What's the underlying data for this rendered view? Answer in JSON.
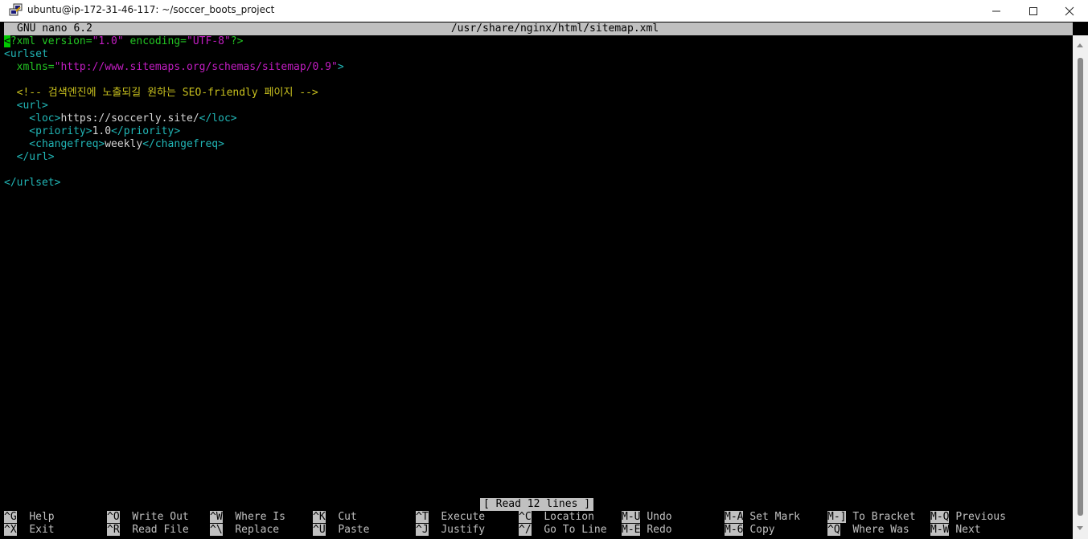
{
  "window": {
    "title": "ubuntu@ip-172-31-46-117: ~/soccer_boots_project",
    "app_icon": "putty-icon",
    "controls": {
      "minimize_icon": "minimize-icon",
      "maximize_icon": "maximize-icon",
      "close_icon": "close-icon"
    }
  },
  "nano": {
    "version_label": "GNU nano 6.2",
    "file_path": "/usr/share/nginx/html/sitemap.xml",
    "status_message": "[ Read 12 lines ]"
  },
  "file_lines": [
    [
      {
        "t": "<",
        "c": "cursor"
      },
      {
        "t": "?xml version=",
        "c": "green"
      },
      {
        "t": "\"1.0\"",
        "c": "magenta"
      },
      {
        "t": " encoding=",
        "c": "green"
      },
      {
        "t": "\"UTF-8\"",
        "c": "magenta"
      },
      {
        "t": "?>",
        "c": "green"
      }
    ],
    [
      {
        "t": "<urlset",
        "c": "teal"
      }
    ],
    [
      {
        "t": "  xmlns=",
        "c": "green"
      },
      {
        "t": "\"http://www.sitemaps.org/schemas/sitemap/0.9\"",
        "c": "magenta"
      },
      {
        "t": ">",
        "c": "teal"
      }
    ],
    [],
    [
      {
        "t": "  <!-- 검색엔진에 노출되길 원하는 SEO-friendly 페이지 -->",
        "c": "yellow"
      }
    ],
    [
      {
        "t": "  <url>",
        "c": "teal"
      }
    ],
    [
      {
        "t": "    <loc>",
        "c": "teal"
      },
      {
        "t": "https://soccerly.site/",
        "c": "white"
      },
      {
        "t": "</loc>",
        "c": "teal"
      }
    ],
    [
      {
        "t": "    <priority>",
        "c": "teal"
      },
      {
        "t": "1.0",
        "c": "white"
      },
      {
        "t": "</priority>",
        "c": "teal"
      }
    ],
    [
      {
        "t": "    <changefreq>",
        "c": "teal"
      },
      {
        "t": "weekly",
        "c": "white"
      },
      {
        "t": "</changefreq>",
        "c": "teal"
      }
    ],
    [
      {
        "t": "  </url>",
        "c": "teal"
      }
    ],
    [],
    [
      {
        "t": "</urlset>",
        "c": "teal"
      }
    ]
  ],
  "shortcuts": {
    "row1": [
      {
        "key": "^G",
        "label": "Help"
      },
      {
        "key": "^O",
        "label": "Write Out"
      },
      {
        "key": "^W",
        "label": "Where Is"
      },
      {
        "key": "^K",
        "label": "Cut"
      },
      {
        "key": "^T",
        "label": "Execute"
      },
      {
        "key": "^C",
        "label": "Location"
      },
      {
        "key": "M-U",
        "label": "Undo"
      },
      {
        "key": "M-A",
        "label": "Set Mark"
      },
      {
        "key": "M-]",
        "label": "To Bracket"
      },
      {
        "key": "M-Q",
        "label": "Previous"
      }
    ],
    "row2": [
      {
        "key": "^X",
        "label": "Exit"
      },
      {
        "key": "^R",
        "label": "Read File"
      },
      {
        "key": "^\\",
        "label": "Replace"
      },
      {
        "key": "^U",
        "label": "Paste"
      },
      {
        "key": "^J",
        "label": "Justify"
      },
      {
        "key": "^/",
        "label": "Go To Line"
      },
      {
        "key": "M-E",
        "label": "Redo"
      },
      {
        "key": "M-6",
        "label": "Copy"
      },
      {
        "key": "^Q",
        "label": "Where Was"
      },
      {
        "key": "M-W",
        "label": "Next"
      }
    ]
  }
}
